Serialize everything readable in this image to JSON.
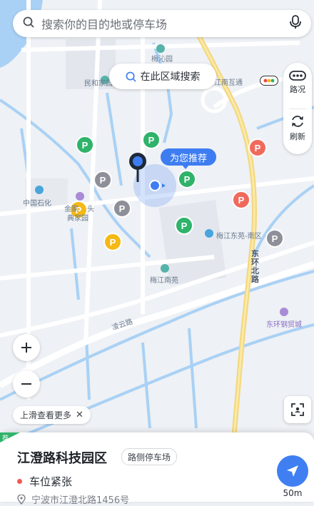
{
  "search": {
    "placeholder": "搜索你的目的地或停车场"
  },
  "area_search": {
    "label": "在此区域搜索"
  },
  "right_panel": {
    "traffic_label": "路况",
    "refresh_label": "刷新"
  },
  "recommend_tag": "为您推荐",
  "hint_chip": {
    "label": "上滑查看更多",
    "close": "✕"
  },
  "map_labels": {
    "meiyuan": "梅沁园",
    "minhe": "民和家园",
    "jiangnan_hutong": "江南互通",
    "sinopec": "中国石化",
    "jinjia": "金家",
    "tou": "头",
    "park": "典家园",
    "meijiang_nanyuan_south": "梅江东苑-南区",
    "meijiang_nanyuan": "梅江南苑",
    "donghuan_beilu": "东环北路",
    "donghuan_steel": "东环钢贸城",
    "lingyun_road": "凌云路"
  },
  "sheet": {
    "corner_tag": "荐",
    "title": "江澄路科技园区",
    "type_badge": "路侧停车场",
    "status": "车位紧张",
    "address": "宁波市江澄北路1456号",
    "distance": "50m"
  },
  "colors": {
    "accent": "#3e7df1",
    "parking_green": "#2fb36a",
    "parking_red": "#f06a5c",
    "parking_yellow": "#f5b915",
    "parking_gray": "#8d9098",
    "water": "#a9d1f5",
    "status_red": "#f05a4f"
  },
  "icons": [
    "search-icon",
    "mic-icon",
    "traffic-icon",
    "refresh-icon",
    "zoom-in-icon",
    "zoom-out-icon",
    "fullscreen-icon",
    "navigate-icon",
    "location-pin-icon",
    "parking-icon"
  ]
}
